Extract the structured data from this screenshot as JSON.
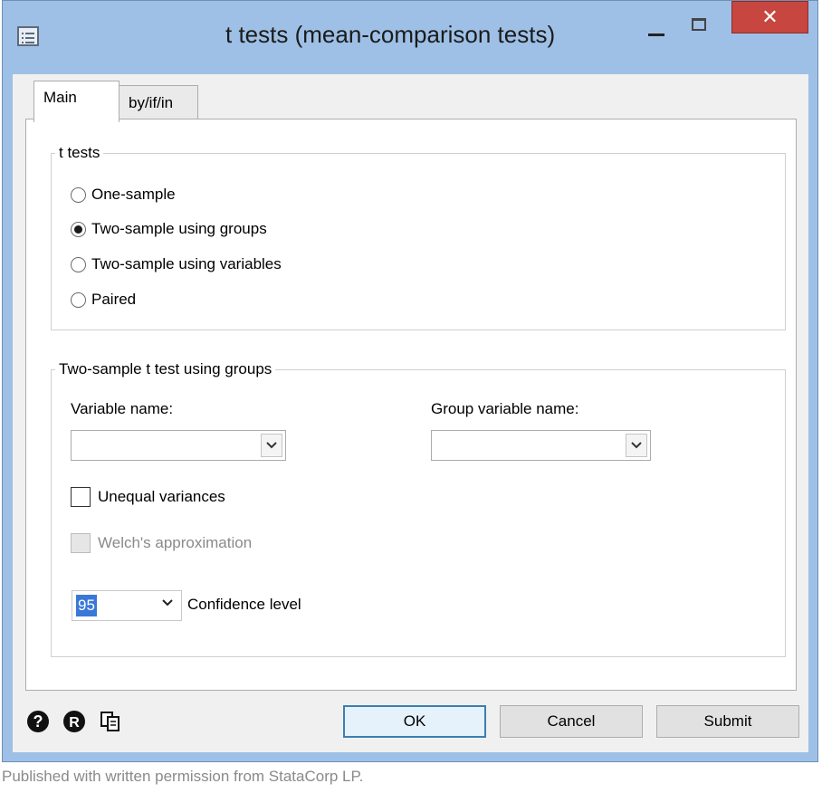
{
  "window": {
    "title": "t tests (mean-comparison tests)",
    "close_glyph": "✕",
    "accent": "#9ec0e6",
    "close_color": "#c7463f"
  },
  "tabs": [
    {
      "label": "Main",
      "selected": true
    },
    {
      "label": "by/if/in",
      "selected": false
    }
  ],
  "t_tests_group": {
    "legend": "t tests",
    "options": [
      {
        "label": "One-sample",
        "selected": false
      },
      {
        "label": "Two-sample using groups",
        "selected": true
      },
      {
        "label": "Two-sample using variables",
        "selected": false
      },
      {
        "label": "Paired",
        "selected": false
      }
    ]
  },
  "two_sample_group": {
    "legend": "Two-sample t test using groups",
    "variable_name_label": "Variable name:",
    "variable_name_value": "",
    "group_variable_label": "Group variable name:",
    "group_variable_value": "",
    "unequal_variances_label": "Unequal variances",
    "unequal_variances_checked": false,
    "welch_label": "Welch's approximation",
    "welch_checked": false,
    "welch_enabled": false,
    "confidence_value": "95",
    "confidence_label": "Confidence level"
  },
  "footer": {
    "icons": [
      "help-icon",
      "reset-icon",
      "copy-command-icon"
    ],
    "ok_label": "OK",
    "cancel_label": "Cancel",
    "submit_label": "Submit"
  },
  "caption": "Published with written permission from StataCorp LP."
}
